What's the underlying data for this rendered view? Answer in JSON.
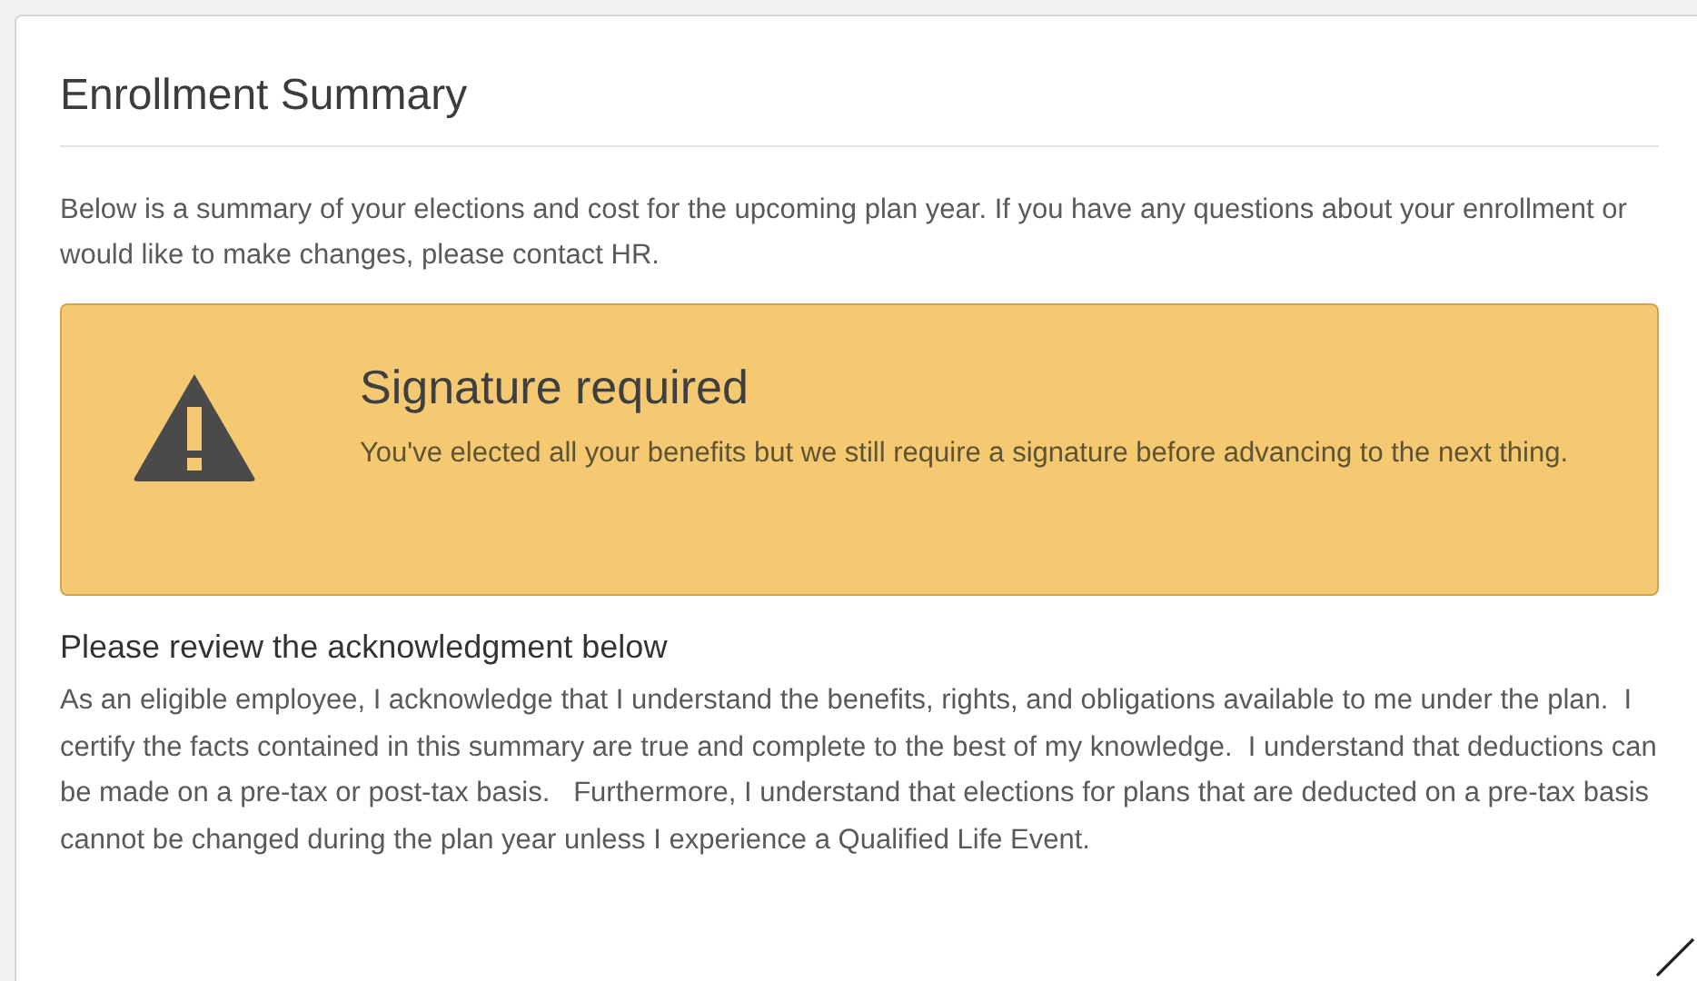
{
  "panel": {
    "title": "Enrollment Summary",
    "intro": "Below is a summary of your elections and cost for the upcoming plan year. If you have any questions about your enrollment or would like to make changes, please contact HR.",
    "alert": {
      "kind": "warning",
      "heading": "Signature required",
      "message": "You've elected all your benefits but we still require a signature before advancing to the next thing."
    },
    "acknowledgment": {
      "heading": "Please review the acknowledgment below",
      "text": "As an eligible employee, I acknowledge that I understand the benefits, rights, and obligations available to me under the plan.  I certify the facts contained in this summary are true and complete to the best of my knowledge.  I understand that deductions can be made on a pre-tax or post-tax basis.   Furthermore, I understand that elections for plans that are deducted on a pre-tax basis cannot be changed during the plan year unless I experience a Qualified Life Event."
    }
  }
}
